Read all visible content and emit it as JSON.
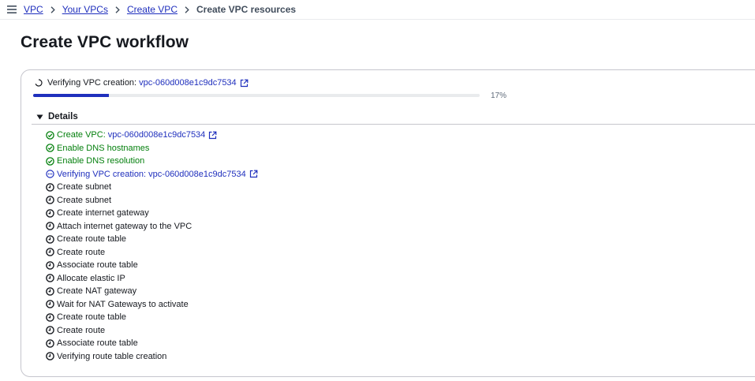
{
  "breadcrumbs": {
    "items": [
      "VPC",
      "Your VPCs",
      "Create VPC"
    ],
    "current": "Create VPC resources"
  },
  "page": {
    "title": "Create VPC workflow"
  },
  "status": {
    "label": "Verifying VPC creation:",
    "link": "vpc-060d008e1c9dc7534",
    "progress_percent": 17,
    "progress_label": "17%"
  },
  "details": {
    "label": "Details",
    "expanded": true,
    "steps": [
      {
        "text": "Create VPC:",
        "link": "vpc-060d008e1c9dc7534",
        "state": "success",
        "icon": "check-circle-icon",
        "external": true
      },
      {
        "text": "Enable DNS hostnames",
        "state": "success",
        "icon": "check-circle-icon"
      },
      {
        "text": "Enable DNS resolution",
        "state": "success",
        "icon": "check-circle-icon"
      },
      {
        "text": "Verifying VPC creation: vpc-060d008e1c9dc7534",
        "state": "in-progress",
        "icon": "in-progress-icon",
        "external": true
      },
      {
        "text": "Create subnet",
        "state": "pending",
        "icon": "clock-icon"
      },
      {
        "text": "Create subnet",
        "state": "pending",
        "icon": "clock-icon"
      },
      {
        "text": "Create internet gateway",
        "state": "pending",
        "icon": "clock-icon"
      },
      {
        "text": "Attach internet gateway to the VPC",
        "state": "pending",
        "icon": "clock-icon"
      },
      {
        "text": "Create route table",
        "state": "pending",
        "icon": "clock-icon"
      },
      {
        "text": "Create route",
        "state": "pending",
        "icon": "clock-icon"
      },
      {
        "text": "Associate route table",
        "state": "pending",
        "icon": "clock-icon"
      },
      {
        "text": "Allocate elastic IP",
        "state": "pending",
        "icon": "clock-icon"
      },
      {
        "text": "Create NAT gateway",
        "state": "pending",
        "icon": "clock-icon"
      },
      {
        "text": "Wait for NAT Gateways to activate",
        "state": "pending",
        "icon": "clock-icon"
      },
      {
        "text": "Create route table",
        "state": "pending",
        "icon": "clock-icon"
      },
      {
        "text": "Create route",
        "state": "pending",
        "icon": "clock-icon"
      },
      {
        "text": "Associate route table",
        "state": "pending",
        "icon": "clock-icon"
      },
      {
        "text": "Verifying route table creation",
        "state": "pending",
        "icon": "clock-icon"
      }
    ]
  },
  "colors": {
    "link": "#1f2fbd",
    "success": "#037f0c",
    "text": "#16191f",
    "border": "#c6c6cd"
  }
}
